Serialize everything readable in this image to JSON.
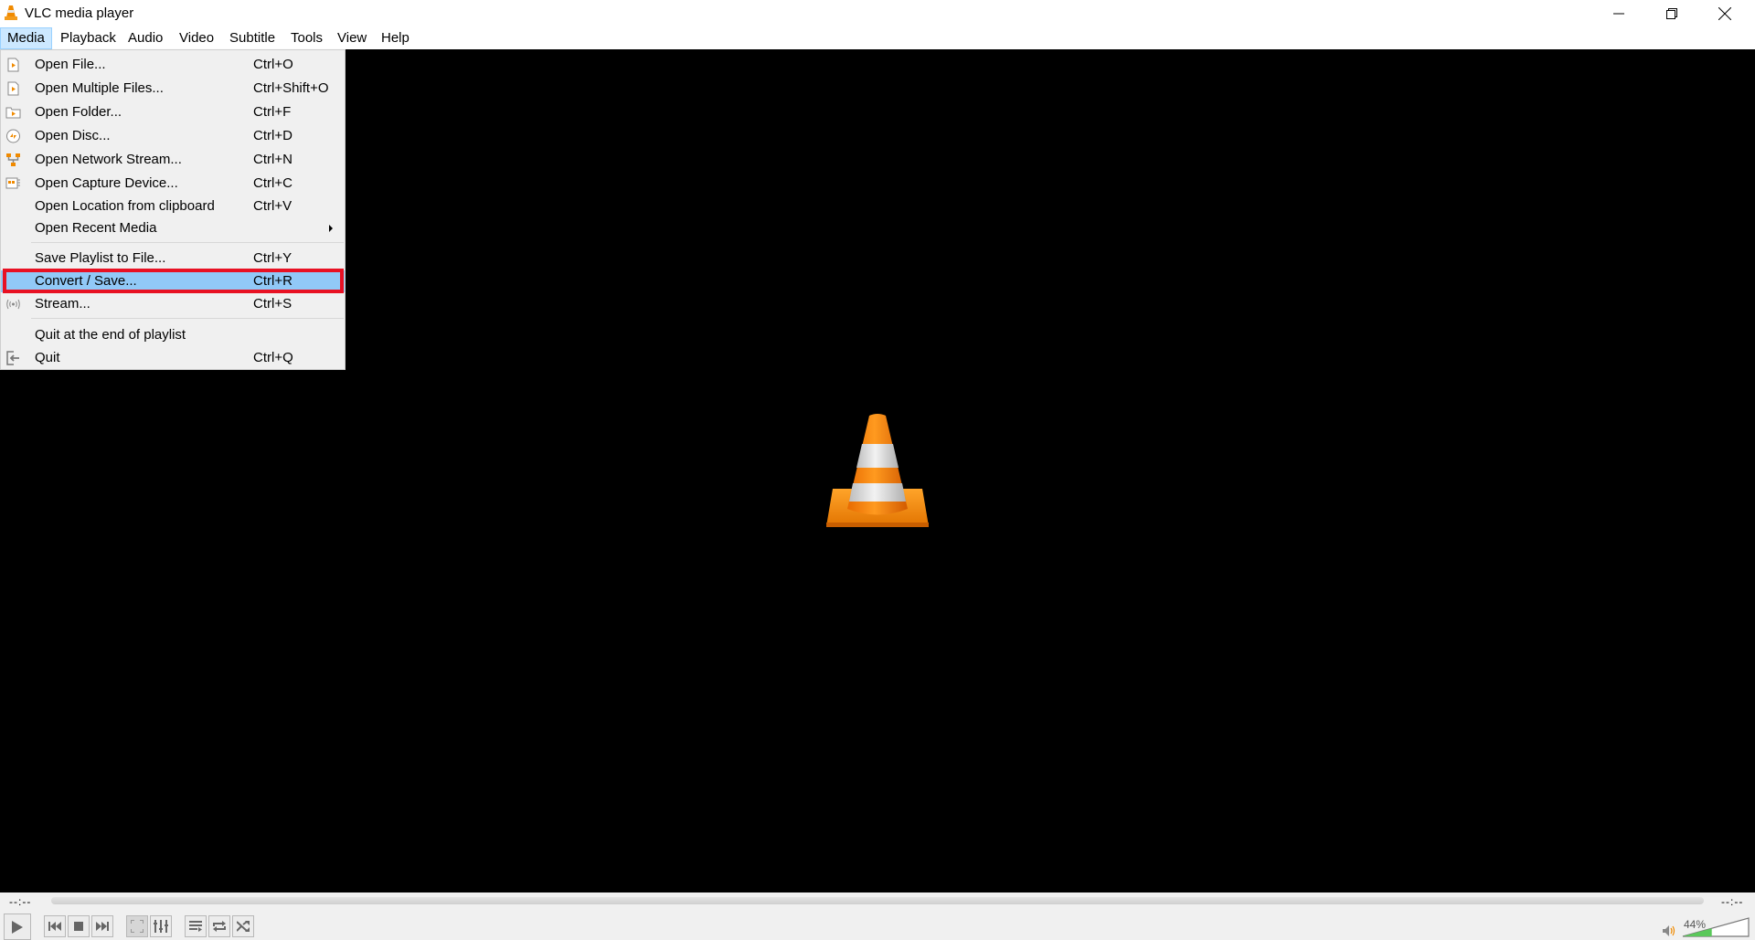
{
  "window": {
    "title": "VLC media player",
    "app_icon": "vlc-cone-icon",
    "controls": [
      "minimize-icon",
      "restore-icon",
      "close-icon"
    ]
  },
  "menubar": {
    "items": [
      {
        "label": "Media",
        "active": true
      },
      {
        "label": "Playback"
      },
      {
        "label": "Audio"
      },
      {
        "label": "Video"
      },
      {
        "label": "Subtitle"
      },
      {
        "label": "Tools"
      },
      {
        "label": "View"
      },
      {
        "label": "Help"
      }
    ]
  },
  "media_menu": {
    "items": [
      {
        "label": "Open File...",
        "shortcut": "Ctrl+O",
        "icon": "open-file-icon"
      },
      {
        "label": "Open Multiple Files...",
        "shortcut": "Ctrl+Shift+O",
        "icon": "open-multiple-files-icon"
      },
      {
        "label": "Open Folder...",
        "shortcut": "Ctrl+F",
        "icon": "open-folder-icon"
      },
      {
        "label": "Open Disc...",
        "shortcut": "Ctrl+D",
        "icon": "disc-icon"
      },
      {
        "label": "Open Network Stream...",
        "shortcut": "Ctrl+N",
        "icon": "network-icon"
      },
      {
        "label": "Open Capture Device...",
        "shortcut": "Ctrl+C",
        "icon": "capture-device-icon"
      },
      {
        "label": "Open Location from clipboard",
        "shortcut": "Ctrl+V"
      },
      {
        "label": "Open Recent Media",
        "shortcut": "",
        "submenu": true
      },
      {
        "label": "Save Playlist to File...",
        "shortcut": "Ctrl+Y"
      },
      {
        "label": "Convert / Save...",
        "shortcut": "Ctrl+R",
        "highlighted": true
      },
      {
        "label": "Stream...",
        "shortcut": "Ctrl+S",
        "icon": "stream-icon"
      },
      {
        "label": "Quit at the end of playlist",
        "shortcut": ""
      },
      {
        "label": "Quit",
        "shortcut": "Ctrl+Q",
        "icon": "quit-icon"
      }
    ],
    "highlight_color": "#91c9f7",
    "annotation_color": "#e81123"
  },
  "player": {
    "elapsed": "--:--",
    "remaining": "--:--",
    "volume_percent": 44,
    "volume_label": "44%",
    "buttons": [
      "play",
      "previous",
      "stop",
      "next",
      "fullscreen",
      "extended-settings",
      "playlist",
      "loop",
      "shuffle"
    ]
  },
  "colors": {
    "video_background": "#000000",
    "menu_background": "#f0f0f0",
    "menubar_active": "#cce8ff",
    "volume_fill": "#5ac85a"
  }
}
